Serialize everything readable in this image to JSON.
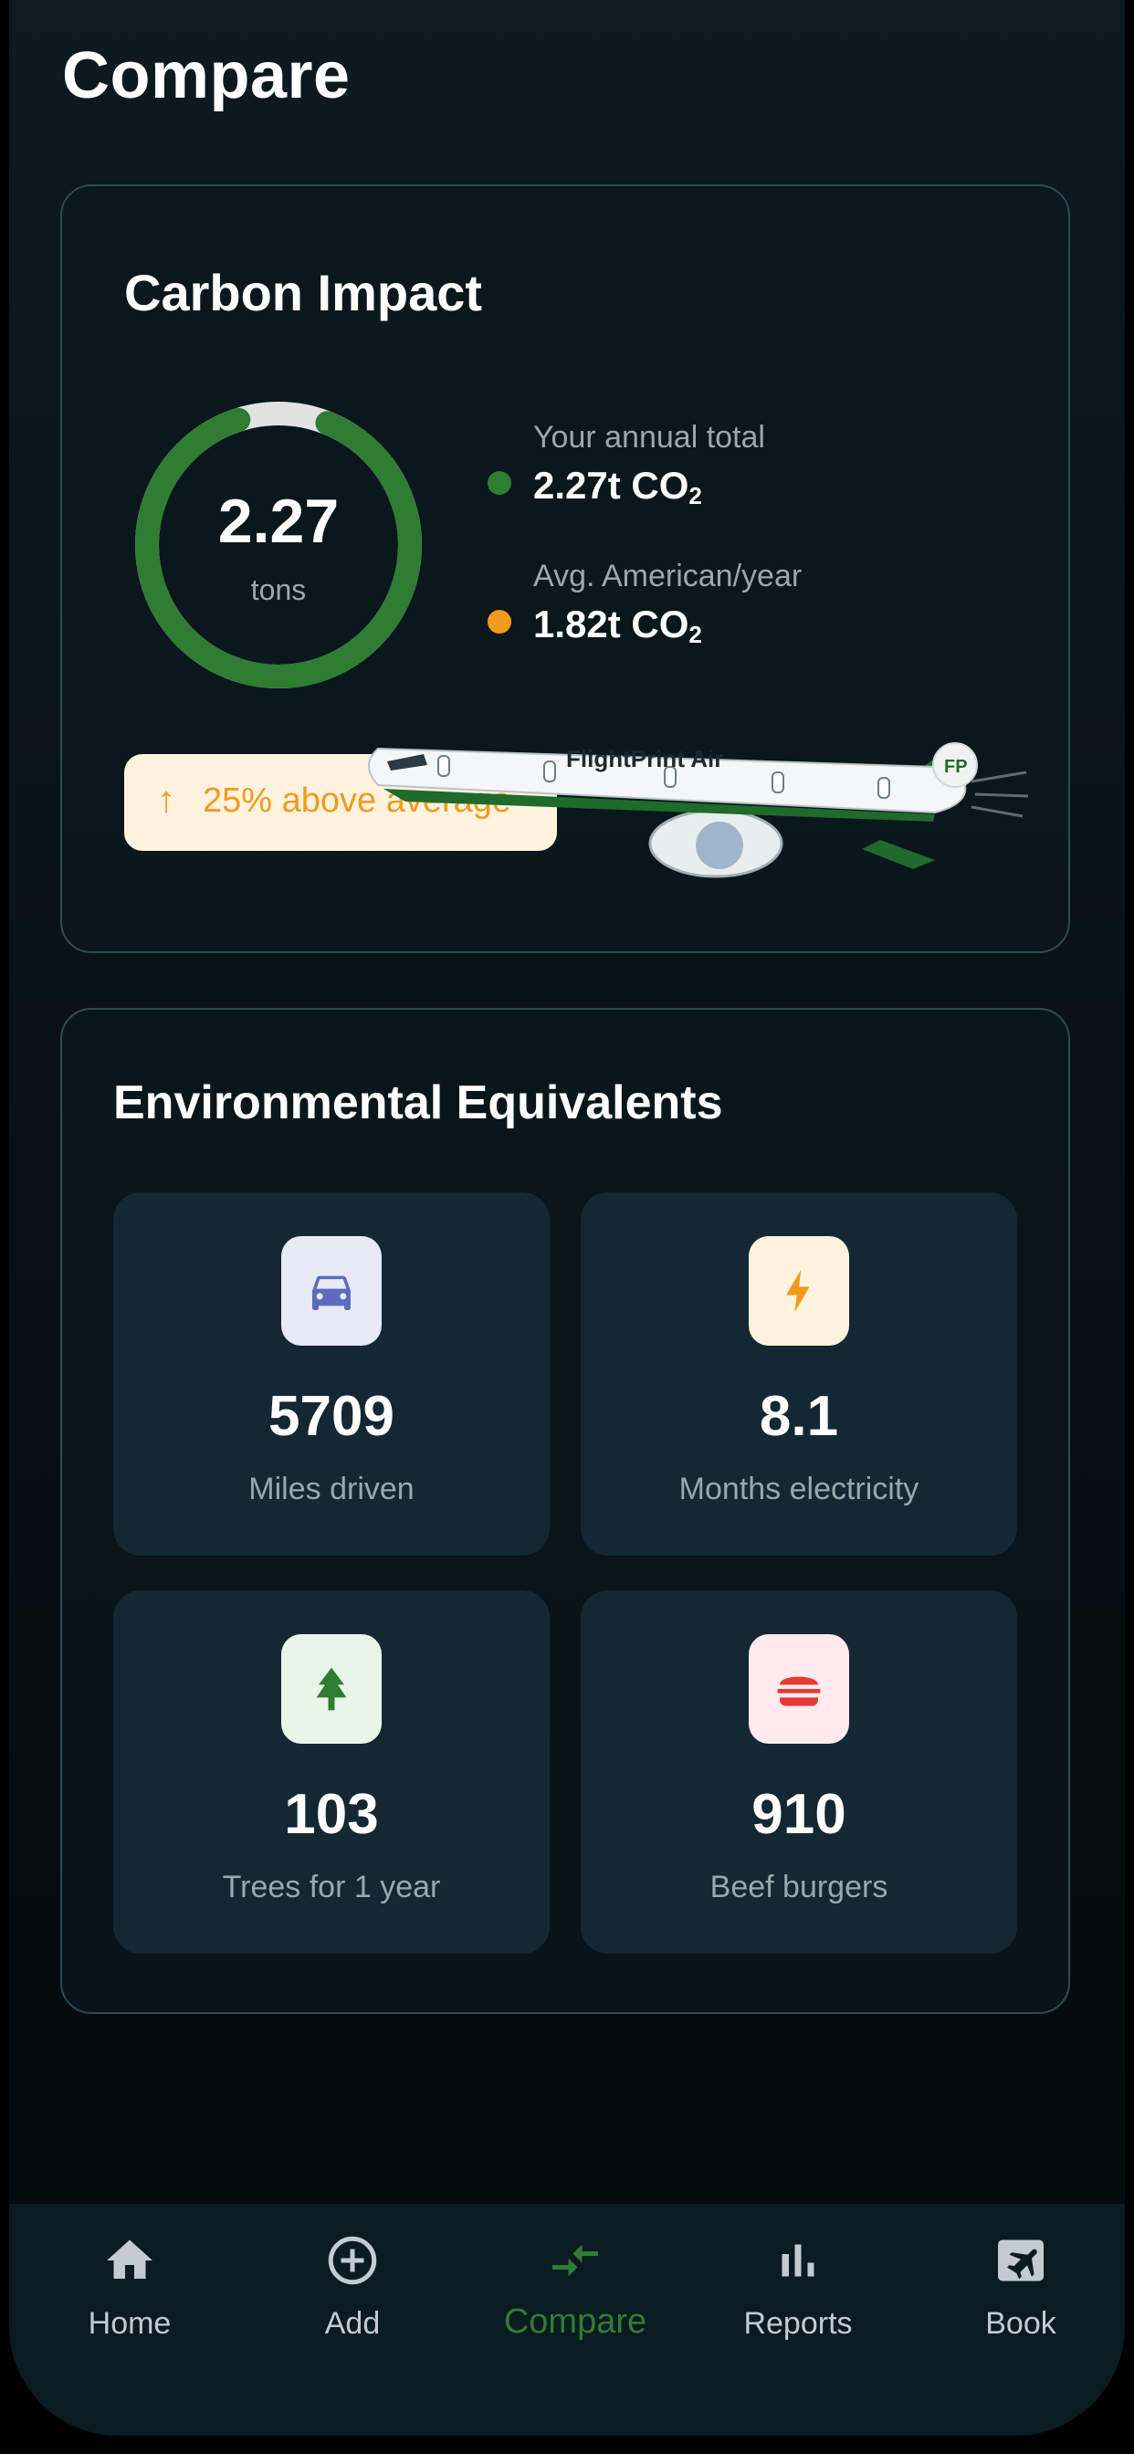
{
  "page": {
    "title": "Compare"
  },
  "carbon_impact": {
    "title": "Carbon Impact",
    "ring": {
      "value": "2.27",
      "unit": "tons",
      "progress_fraction": 0.89
    },
    "legend": [
      {
        "label": "Your annual total",
        "value": "2.27t CO",
        "sub": "2",
        "color": "#2e7d32"
      },
      {
        "label": "Avg. American/year",
        "value": "1.82t CO",
        "sub": "2",
        "color": "#f29a1c"
      }
    ],
    "badge": {
      "icon": "arrow-up-icon",
      "text": "25% above average"
    },
    "airline_logo": {
      "name": "FlightPrint Air",
      "tail_mark": "FP"
    }
  },
  "environmental_equivalents": {
    "title": "Environmental Equivalents",
    "tiles": [
      {
        "value": "5709",
        "label": "Miles driven",
        "icon": "car-icon",
        "icon_bg": "#e8eaf6",
        "icon_color": "#5c6bc0"
      },
      {
        "value": "8.1",
        "label": "Months electricity",
        "icon": "lightning-icon",
        "icon_bg": "#fff3e0",
        "icon_color": "#f29a1c"
      },
      {
        "value": "103",
        "label": "Trees for 1 year",
        "icon": "tree-icon",
        "icon_bg": "#e8f5e9",
        "icon_color": "#2e7d32"
      },
      {
        "value": "910",
        "label": "Beef burgers",
        "icon": "burger-icon",
        "icon_bg": "#ffebee",
        "icon_color": "#e53935"
      }
    ]
  },
  "tabbar": {
    "active": "Compare",
    "tabs": [
      {
        "label": "Home",
        "icon": "home-icon"
      },
      {
        "label": "Add",
        "icon": "add-circle-icon"
      },
      {
        "label": "Compare",
        "icon": "compare-arrows-icon"
      },
      {
        "label": "Reports",
        "icon": "bar-chart-icon"
      },
      {
        "label": "Book",
        "icon": "flight-ticket-icon"
      }
    ]
  }
}
